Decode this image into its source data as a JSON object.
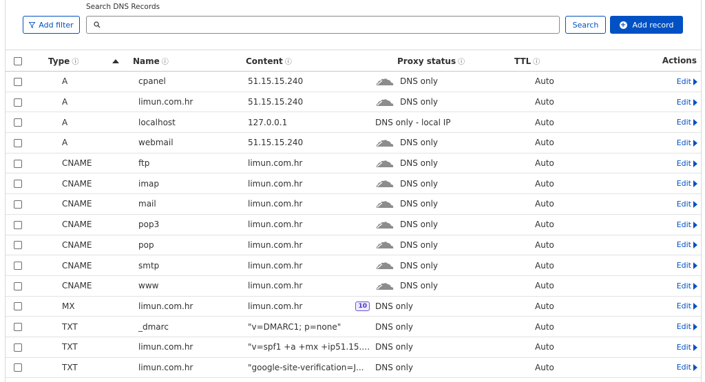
{
  "toolbar": {
    "filter_label": "Add filter",
    "search_label": "Search DNS Records",
    "search_value": "",
    "search_button": "Search",
    "add_button": "Add record"
  },
  "columns": {
    "type": "Type",
    "name": "Name",
    "content": "Content",
    "proxy": "Proxy status",
    "ttl": "TTL",
    "actions": "Actions"
  },
  "info_glyph": "ⓘ",
  "edit_label": "Edit",
  "records": [
    {
      "type": "A",
      "name": "cpanel",
      "content": "51.15.15.240",
      "priority": "",
      "proxy": "DNS only",
      "cloud": true,
      "ttl": "Auto"
    },
    {
      "type": "A",
      "name": "limun.com.hr",
      "content": "51.15.15.240",
      "priority": "",
      "proxy": "DNS only",
      "cloud": true,
      "ttl": "Auto"
    },
    {
      "type": "A",
      "name": "localhost",
      "content": "127.0.0.1",
      "priority": "",
      "proxy": "DNS only - local IP",
      "cloud": false,
      "ttl": "Auto"
    },
    {
      "type": "A",
      "name": "webmail",
      "content": "51.15.15.240",
      "priority": "",
      "proxy": "DNS only",
      "cloud": true,
      "ttl": "Auto"
    },
    {
      "type": "CNAME",
      "name": "ftp",
      "content": "limun.com.hr",
      "priority": "",
      "proxy": "DNS only",
      "cloud": true,
      "ttl": "Auto"
    },
    {
      "type": "CNAME",
      "name": "imap",
      "content": "limun.com.hr",
      "priority": "",
      "proxy": "DNS only",
      "cloud": true,
      "ttl": "Auto"
    },
    {
      "type": "CNAME",
      "name": "mail",
      "content": "limun.com.hr",
      "priority": "",
      "proxy": "DNS only",
      "cloud": true,
      "ttl": "Auto"
    },
    {
      "type": "CNAME",
      "name": "pop3",
      "content": "limun.com.hr",
      "priority": "",
      "proxy": "DNS only",
      "cloud": true,
      "ttl": "Auto"
    },
    {
      "type": "CNAME",
      "name": "pop",
      "content": "limun.com.hr",
      "priority": "",
      "proxy": "DNS only",
      "cloud": true,
      "ttl": "Auto"
    },
    {
      "type": "CNAME",
      "name": "smtp",
      "content": "limun.com.hr",
      "priority": "",
      "proxy": "DNS only",
      "cloud": true,
      "ttl": "Auto"
    },
    {
      "type": "CNAME",
      "name": "www",
      "content": "limun.com.hr",
      "priority": "",
      "proxy": "DNS only",
      "cloud": true,
      "ttl": "Auto"
    },
    {
      "type": "MX",
      "name": "limun.com.hr",
      "content": "limun.com.hr",
      "priority": "10",
      "proxy": "DNS only",
      "cloud": false,
      "ttl": "Auto"
    },
    {
      "type": "TXT",
      "name": "_dmarc",
      "content": "\"v=DMARC1; p=none\"",
      "priority": "",
      "proxy": "DNS only",
      "cloud": false,
      "ttl": "Auto"
    },
    {
      "type": "TXT",
      "name": "limun.com.hr",
      "content": "\"v=spf1 +a +mx +ip51.15.15...",
      "priority": "",
      "proxy": "DNS only",
      "cloud": false,
      "ttl": "Auto"
    },
    {
      "type": "TXT",
      "name": "limun.com.hr",
      "content": "\"google-site-verification=J...",
      "priority": "",
      "proxy": "DNS only",
      "cloud": false,
      "ttl": "Auto"
    }
  ]
}
